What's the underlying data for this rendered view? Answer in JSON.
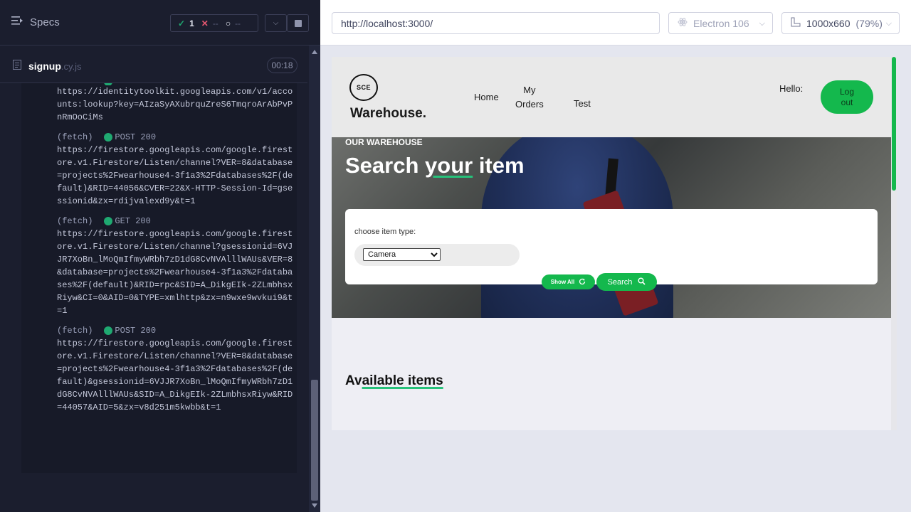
{
  "runner": {
    "specs_label": "Specs",
    "stats": {
      "passed": "1",
      "failed": "--",
      "pending": "--"
    },
    "spec": {
      "name": "signup",
      "ext": ".cy.js",
      "duration": "00:18"
    },
    "logs": [
      {
        "type": "",
        "method": "",
        "url": "https://identitytoolkit.googleapis.com/v1/accounts:lookup?key=AIzaSyAXubrquZreS6TmqroArAbPvPnRmOoCiMs",
        "partial": true
      },
      {
        "type": "(fetch)",
        "method": "POST 200",
        "url": "https://firestore.googleapis.com/google.firestore.v1.Firestore/Listen/channel?VER=8&database=projects%2Fwearhouse4-3f1a3%2Fdatabases%2F(default)&RID=44056&CVER=22&X-HTTP-Session-Id=gsessionid&zx=rdijvalexd9y&t=1"
      },
      {
        "type": "(fetch)",
        "method": "GET 200",
        "url": "https://firestore.googleapis.com/google.firestore.v1.Firestore/Listen/channel?gsessionid=6VJJR7XoBn_lMoQmIfmyWRbh7zD1dG8CvNVAlllWAUs&VER=8&database=projects%2Fwearhouse4-3f1a3%2Fdatabases%2F(default)&RID=rpc&SID=A_DikgEIk-2ZLmbhsxRiyw&CI=0&AID=0&TYPE=xmlhttp&zx=n9wxe9wvkui9&t=1"
      },
      {
        "type": "(fetch)",
        "method": "POST 200",
        "url": "https://firestore.googleapis.com/google.firestore.v1.Firestore/Listen/channel?VER=8&database=projects%2Fwearhouse4-3f1a3%2Fdatabases%2F(default)&gsessionid=6VJJR7XoBn_lMoQmIfmyWRbh7zD1dG8CvNVAlllWAUs&SID=A_DikgEIk-2ZLmbhsxRiyw&RID=44057&AID=5&zx=v8d251m5kwbb&t=1"
      }
    ]
  },
  "aut_bar": {
    "url": "http://localhost:3000/",
    "browser": "Electron 106",
    "viewport": "1000x660",
    "zoom": "(79%)"
  },
  "app": {
    "logo_badge": "SCE",
    "logo_text": "Warehouse.",
    "nav": {
      "home": "Home",
      "my_orders_line1": "My",
      "my_orders_line2": "Orders",
      "test": "Test"
    },
    "hello": "Hello:",
    "logout_line1": "Log",
    "logout_line2": "out",
    "hero": {
      "subtitle": "OUR WAREHOUSE",
      "title_pre": "Search ",
      "title_your": "your",
      "title_item": " item"
    },
    "search": {
      "label": "choose item type:",
      "selected": "Camera",
      "show_all": "Show All",
      "search": "Search"
    },
    "available_pre": "Av",
    "available_ul": "ailable items"
  },
  "colors": {
    "accent_green": "#14b84d",
    "runner_bg": "#1b1e2e",
    "pass_green": "#1fa971",
    "fail_red": "#e45770"
  }
}
